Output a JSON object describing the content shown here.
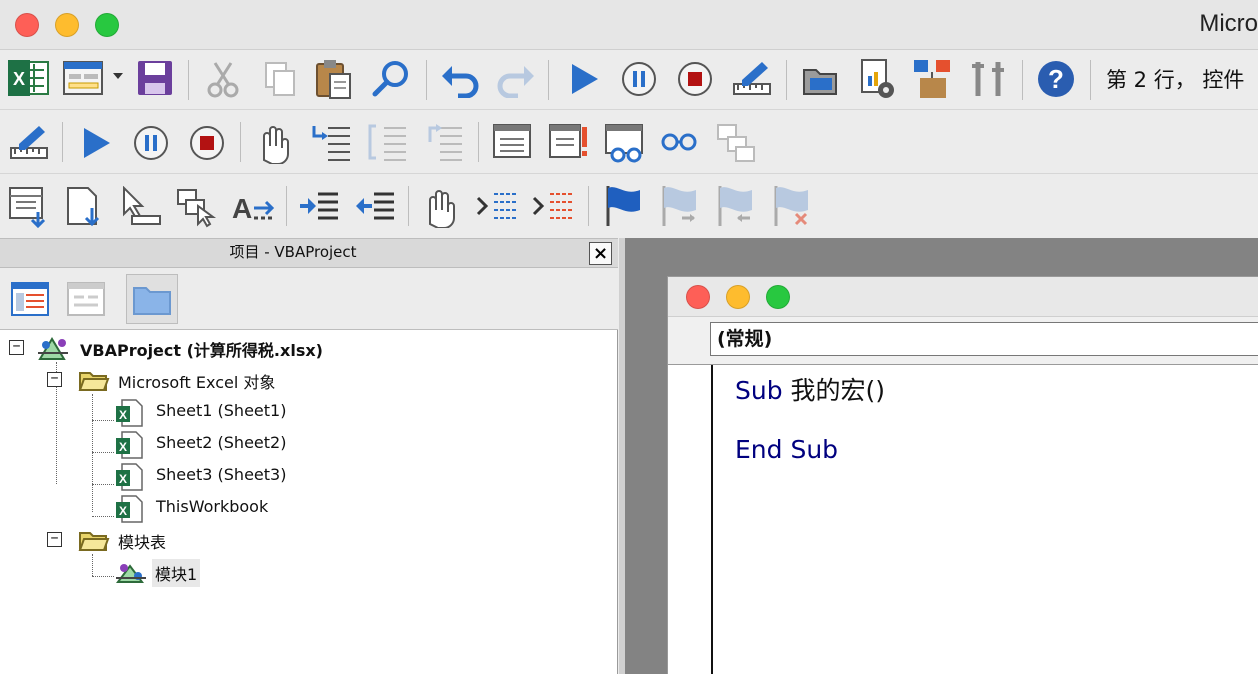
{
  "app": {
    "title": "Micro"
  },
  "toolbar": {
    "status_text": "第 2 行， 控件",
    "row1": [
      "excel-icon",
      "insert-userform-icon",
      "save-icon",
      "cut-icon",
      "copy-icon",
      "paste-icon",
      "find-icon",
      "undo-icon",
      "redo-icon",
      "run-icon",
      "break-icon",
      "reset-icon",
      "design-mode-icon",
      "project-explorer-icon",
      "properties-icon",
      "object-browser-icon",
      "toolbox-icon",
      "help-icon"
    ],
    "row2": [
      "design-mode-icon",
      "run-icon",
      "break-icon",
      "reset-icon",
      "toggle-breakpoint-icon",
      "step-into-icon",
      "step-over-icon",
      "step-out-icon",
      "locals-window-icon",
      "immediate-window-icon",
      "watch-window-icon",
      "quick-watch-icon",
      "call-stack-icon"
    ],
    "row3": [
      "list-properties-icon",
      "list-constants-icon",
      "quick-info-icon",
      "parameter-info-icon",
      "complete-word-icon",
      "indent-icon",
      "outdent-icon",
      "toggle-breakpoint-icon",
      "comment-block-icon",
      "uncomment-block-icon",
      "toggle-bookmark-icon",
      "next-bookmark-icon",
      "previous-bookmark-icon",
      "clear-bookmarks-icon"
    ]
  },
  "project": {
    "title": "项目 - VBAProject",
    "close_label": "×",
    "tools": [
      "view-code-icon",
      "view-object-icon",
      "toggle-folders-icon"
    ],
    "tree": {
      "root": {
        "name": "VBAProject",
        "file": " (计算所得税.xlsx)",
        "expander": "−"
      },
      "group1": {
        "label": "Microsoft Excel 对象",
        "expander": "−"
      },
      "items1": [
        "Sheet1 (Sheet1)",
        "Sheet2 (Sheet2)",
        "Sheet3 (Sheet3)",
        "ThisWorkbook"
      ],
      "group2": {
        "label": "模块表",
        "expander": "−"
      },
      "items2": [
        "模块1"
      ]
    }
  },
  "code": {
    "object_combo": "(常规)",
    "lines": [
      {
        "keyword": "Sub",
        "text": " 我的宏()"
      },
      {
        "keyword": "End Sub",
        "text": ""
      }
    ]
  },
  "colors": {
    "keyword": "#00007f",
    "close": "#fe5f57",
    "minimize": "#febc2e",
    "zoom": "#28c840",
    "accent_blue": "#2a6fc9"
  }
}
